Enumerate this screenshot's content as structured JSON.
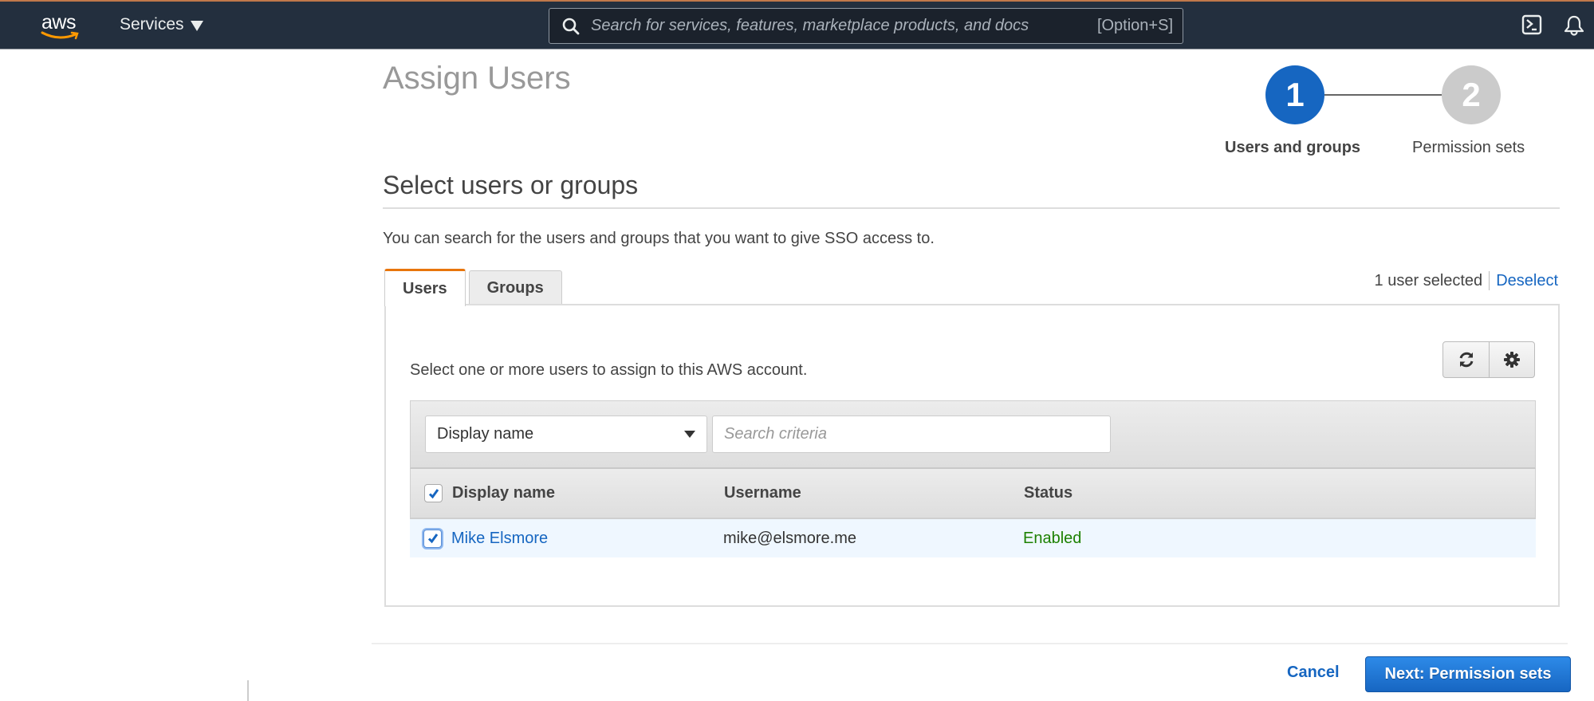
{
  "nav": {
    "logo_text": "aws",
    "services_label": "Services",
    "search_placeholder": "Search for services, features, marketplace products, and docs",
    "search_shortcut": "[Option+S]",
    "icons": [
      "search-icon",
      "cloudshell-icon",
      "bell-icon"
    ]
  },
  "page": {
    "title": "Assign Users"
  },
  "stepper": {
    "steps": [
      {
        "number": "1",
        "label": "Users and groups",
        "state": "active"
      },
      {
        "number": "2",
        "label": "Permission sets",
        "state": "inactive"
      }
    ],
    "colors": {
      "active": "#1666c1",
      "inactive": "#cbcbcb"
    }
  },
  "section": {
    "title": "Select users or groups",
    "description": "You can search for the users and groups that you want to give SSO access to."
  },
  "tabs": [
    {
      "label": "Users",
      "active": true
    },
    {
      "label": "Groups",
      "active": false
    }
  ],
  "selection": {
    "count_text": "1 user selected",
    "deselect_label": "Deselect"
  },
  "panel": {
    "description": "Select one or more users to assign to this AWS account.",
    "buttons": [
      "refresh-icon",
      "settings-icon"
    ]
  },
  "filter": {
    "attribute_selected": "Display name",
    "criteria_placeholder": "Search criteria",
    "criteria_value": ""
  },
  "table": {
    "select_all_checked": true,
    "columns": [
      "Display name",
      "Username",
      "Status"
    ],
    "rows": [
      {
        "display_name": "Mike Elsmore",
        "username": "mike@elsmore.me",
        "status": "Enabled",
        "checked": true
      }
    ]
  },
  "footer": {
    "cancel_label": "Cancel",
    "next_label": "Next: Permission sets"
  },
  "colors": {
    "nav_bg": "#232f3e",
    "accent_orange": "#e8750c",
    "link_blue": "#1666c1",
    "status_green": "#1d8102",
    "selected_row": "#eff7ff"
  }
}
